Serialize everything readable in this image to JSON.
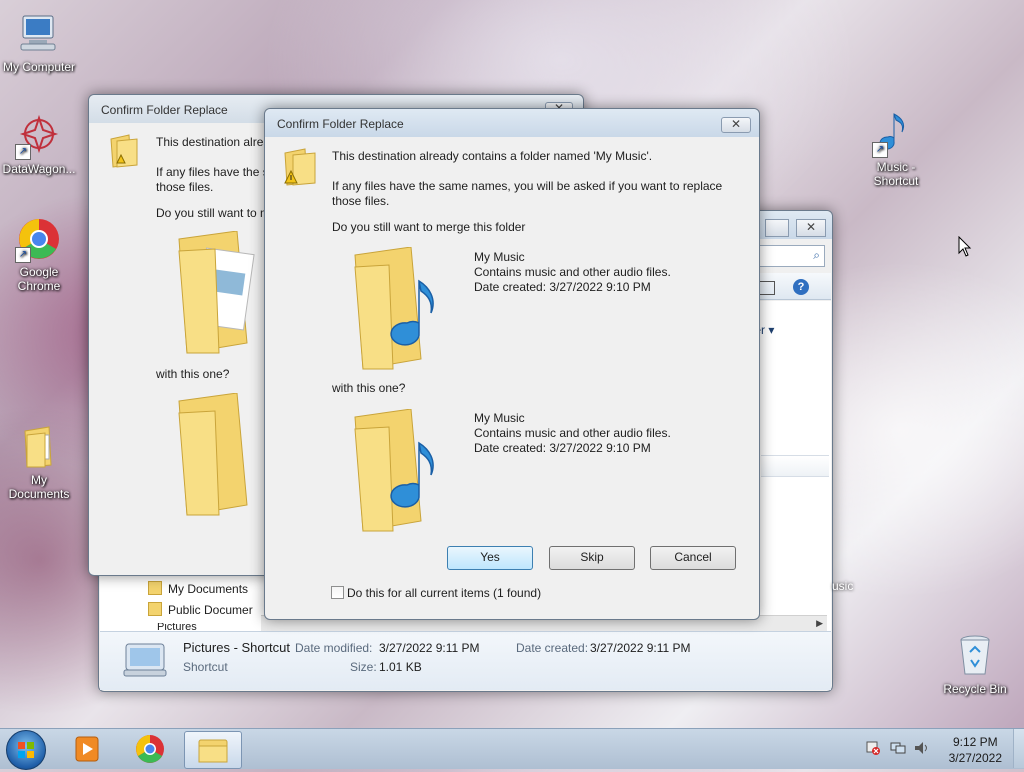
{
  "desktop": {
    "icons": [
      {
        "label": "My Computer"
      },
      {
        "label": "DataWagon..."
      },
      {
        "label": "Google Chrome"
      },
      {
        "label": "My Documents"
      },
      {
        "label": "Music - Shortcut"
      },
      {
        "label": "Recycle Bin"
      }
    ],
    "partial_label": "usic"
  },
  "explorer": {
    "nav_items": [
      "My Documents",
      "Public Documer",
      "Pictures"
    ],
    "partial_menu": "lder",
    "details": {
      "name": "Pictures - Shortcut",
      "type": "Shortcut",
      "date_modified_label": "Date modified:",
      "date_modified": "3/27/2022 9:11 PM",
      "size_label": "Size:",
      "size": "1.01 KB",
      "date_created_label": "Date created:",
      "date_created": "3/27/2022 9:11 PM"
    }
  },
  "back_dialog": {
    "title": "Confirm Folder Replace",
    "line1": "This destination alrea",
    "line2a": "If any files have the s",
    "line2b": "those files.",
    "line3": "Do you still want to m",
    "with_this": "with this one?"
  },
  "dialog": {
    "title": "Confirm Folder Replace",
    "message": "This destination already contains a folder named 'My Music'.",
    "info_line1": "If any files have the same names, you will be asked if you want to replace",
    "info_line2": "those files.",
    "question": "Do you still want to merge this folder",
    "with_this": "with this one?",
    "source": {
      "name": "My Music",
      "desc": "Contains music and other audio files.",
      "date": "Date created: 3/27/2022 9:10 PM"
    },
    "target": {
      "name": "My Music",
      "desc": "Contains music and other audio files.",
      "date": "Date created: 3/27/2022 9:10 PM"
    },
    "buttons": {
      "yes": "Yes",
      "skip": "Skip",
      "cancel": "Cancel"
    },
    "checkbox_label": "Do this for all current items (1 found)",
    "checkbox_checked": false
  },
  "taskbar": {
    "time": "9:12 PM",
    "date": "3/27/2022"
  },
  "colors": {
    "accent": "#3c7fb1",
    "folder": "#f3d36e",
    "note": "#2f8fd8"
  }
}
